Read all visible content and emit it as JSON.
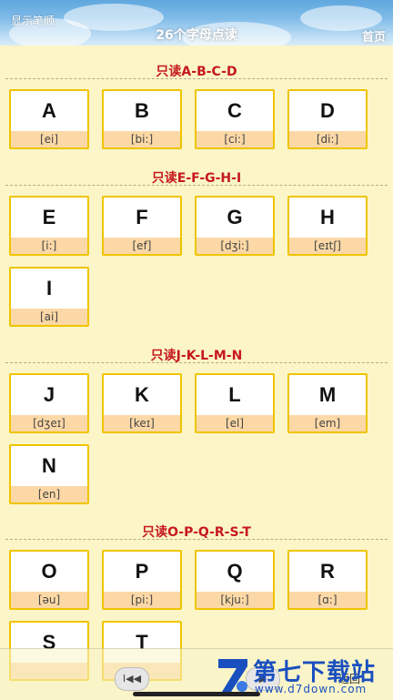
{
  "header": {
    "left_label": "显示笔顺",
    "title": "26个字母点读",
    "right_label": "首页"
  },
  "sections": [
    {
      "title": "只读A-B-C-D",
      "letters": [
        {
          "letter": "A",
          "ipa": "[ei]"
        },
        {
          "letter": "B",
          "ipa": "[bi:]"
        },
        {
          "letter": "C",
          "ipa": "[ci:]"
        },
        {
          "letter": "D",
          "ipa": "[di:]"
        }
      ]
    },
    {
      "title": "只读E-F-G-H-I",
      "letters": [
        {
          "letter": "E",
          "ipa": "[i:]"
        },
        {
          "letter": "F",
          "ipa": "[ef]"
        },
        {
          "letter": "G",
          "ipa": "[dʒi:]"
        },
        {
          "letter": "H",
          "ipa": "[eɪtʃ]"
        },
        {
          "letter": "I",
          "ipa": "[ai]"
        }
      ]
    },
    {
      "title": "只读J-K-L-M-N",
      "letters": [
        {
          "letter": "J",
          "ipa": "[dʒeɪ]"
        },
        {
          "letter": "K",
          "ipa": "[keɪ]"
        },
        {
          "letter": "L",
          "ipa": "[el]"
        },
        {
          "letter": "M",
          "ipa": "[em]"
        },
        {
          "letter": "N",
          "ipa": "[en]"
        }
      ]
    },
    {
      "title": "只读O-P-Q-R-S-T",
      "letters": [
        {
          "letter": "O",
          "ipa": "[əu]"
        },
        {
          "letter": "P",
          "ipa": "[pi:]"
        },
        {
          "letter": "Q",
          "ipa": "[kju:]"
        },
        {
          "letter": "R",
          "ipa": "[ɑ:]"
        },
        {
          "letter": "S",
          "ipa": ""
        },
        {
          "letter": "T",
          "ipa": ""
        }
      ]
    }
  ],
  "bottom": {
    "prev_icon": "skip-previous-icon",
    "prev_glyph": "I◀◀",
    "next_icon": "play-next-icon",
    "next_glyph": "▶",
    "next_label": "返回"
  },
  "watermark": {
    "cn": "第七下载站",
    "en": "www.d7down.com"
  },
  "colors": {
    "background": "#fbf5c7",
    "section_title": "#c6191d",
    "card_border": "#f0c400",
    "ipa_band": "#fbd8a6",
    "watermark": "#1a4fbf"
  }
}
